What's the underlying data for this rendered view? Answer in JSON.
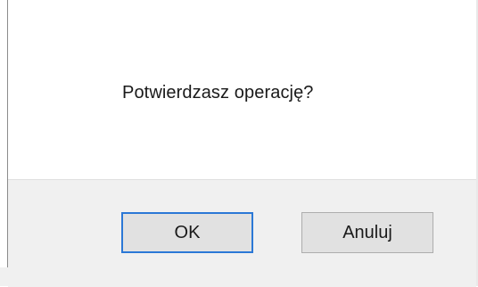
{
  "dialog": {
    "message": "Potwierdzasz operację?",
    "buttons": {
      "ok_label": "OK",
      "cancel_label": "Anuluj"
    }
  },
  "colors": {
    "content_background": "#ffffff",
    "button_bar_background": "#f0f0f0",
    "button_face": "#e1e1e1",
    "button_border": "#adadad",
    "default_button_focus": "#2b78d6"
  }
}
